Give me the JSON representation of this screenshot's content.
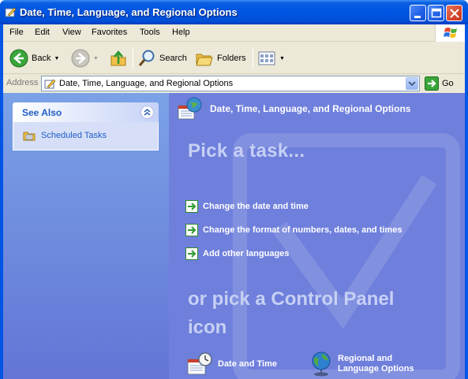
{
  "window": {
    "title": "Date, Time, Language, and Regional Options",
    "colors": {
      "titlebar": "#0054e3",
      "close_button": "#d6452a",
      "task_pane": "#6f7fdc"
    }
  },
  "menu": {
    "items": [
      "File",
      "Edit",
      "View",
      "Favorites",
      "Tools",
      "Help"
    ]
  },
  "toolbar": {
    "back_label": "Back",
    "search_label": "Search",
    "folders_label": "Folders"
  },
  "address": {
    "label": "Address",
    "value": "Date, Time, Language, and Regional Options",
    "go_label": "Go"
  },
  "see_also": {
    "title": "See Also",
    "items": [
      {
        "label": "Scheduled Tasks",
        "icon": "scheduled-tasks-icon"
      }
    ]
  },
  "main": {
    "category_title": "Date, Time, Language, and Regional Options",
    "pick_task": "Pick a task...",
    "tasks": [
      {
        "label": "Change the date and time"
      },
      {
        "label": "Change the format of numbers, dates, and times"
      },
      {
        "label": "Add other languages"
      }
    ],
    "pick_icon_line1": "or pick a Control Panel",
    "pick_icon_line2": "icon",
    "icons": [
      {
        "label": "Date and Time",
        "icon": "date-time-icon"
      },
      {
        "label_line1": "Regional and",
        "label_line2": "Language Options",
        "icon": "globe-icon"
      }
    ]
  }
}
